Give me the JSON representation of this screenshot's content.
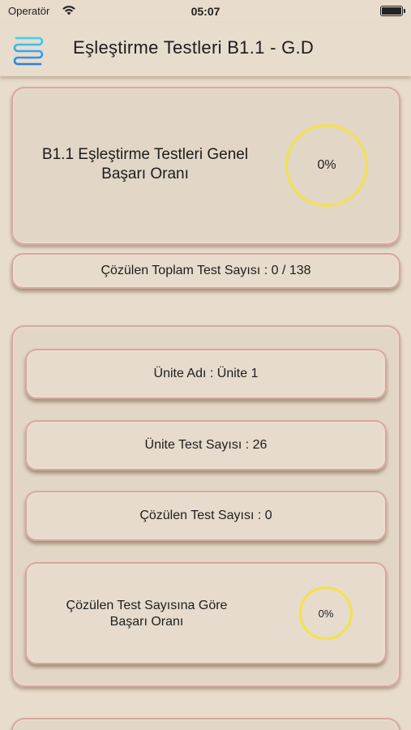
{
  "status_bar": {
    "carrier": "Operatör",
    "time": "05:07",
    "wifi_icon": "wifi-icon",
    "battery_icon": "battery-icon"
  },
  "nav": {
    "title": "Eşleştirme Testleri B1.1 - G.D",
    "menu_icon": "menu-icon"
  },
  "summary": {
    "title": "B1.1 Eşleştirme Testleri Genel Başarı Oranı",
    "percent": "0%",
    "total_solved": "Çözülen Toplam Test Sayısı : 0 / 138"
  },
  "unit": {
    "name": "Ünite Adı : Ünite 1",
    "test_count": "Ünite Test Sayısı : 26",
    "solved_count": "Çözülen Test Sayısı : 0",
    "success_label": "Çözülen Test Sayısına Göre Başarı Oranı",
    "success_percent": "0%"
  },
  "colors": {
    "background": "#e8dccc",
    "card": "#e2d6c6",
    "card_border": "#d8a9a0",
    "progress_ring": "#f3e24a",
    "menu_icon_gradient": [
      "#3fd1f0",
      "#2a7de8"
    ]
  }
}
